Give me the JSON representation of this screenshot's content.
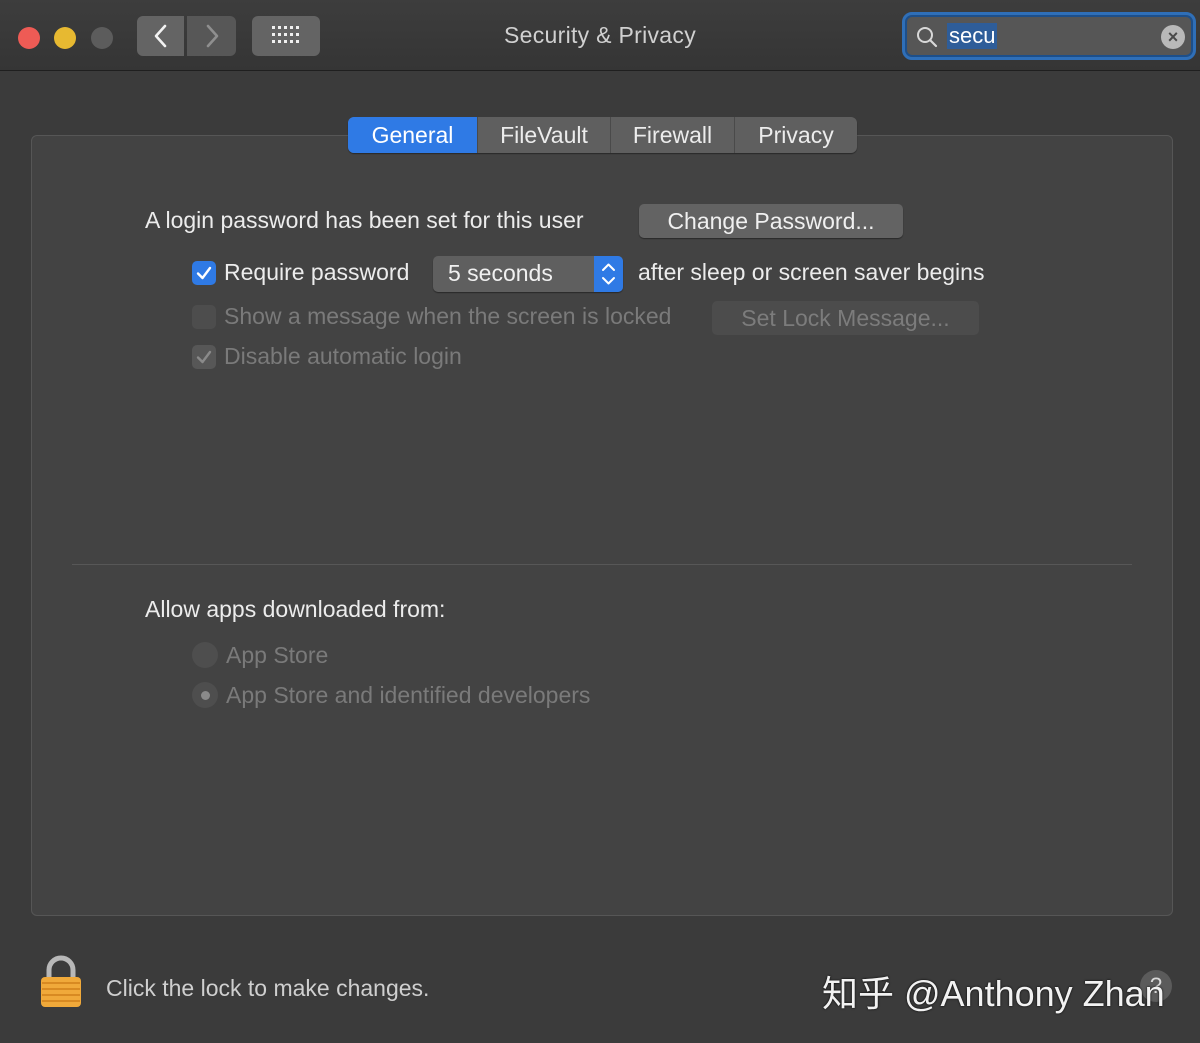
{
  "window": {
    "title": "Security & Privacy"
  },
  "search": {
    "value": "secu",
    "icon": "search-icon",
    "clear_icon": "clear-icon"
  },
  "tabs": [
    {
      "label": "General",
      "active": true
    },
    {
      "label": "FileVault",
      "active": false
    },
    {
      "label": "Firewall",
      "active": false
    },
    {
      "label": "Privacy",
      "active": false
    }
  ],
  "general": {
    "login_password_text": "A login password has been set for this user",
    "change_password_button": "Change Password...",
    "require_password_label": "Require password",
    "require_password_checked": true,
    "require_password_delay": "5 seconds",
    "after_sleep_text": "after sleep or screen saver begins",
    "show_message_label": "Show a message when the screen is locked",
    "show_message_checked": false,
    "set_lock_message_button": "Set Lock Message...",
    "disable_auto_login_label": "Disable automatic login",
    "disable_auto_login_checked": true
  },
  "gatekeeper": {
    "heading": "Allow apps downloaded from:",
    "options": [
      {
        "label": "App Store",
        "selected": false
      },
      {
        "label": "App Store and identified developers",
        "selected": true
      }
    ]
  },
  "footer": {
    "lock_text": "Click the lock to make changes.",
    "watermark": "知乎 @Anthony Zhan",
    "help_label": "?"
  },
  "colors": {
    "accent": "#2f7ae5",
    "close": "#ee5b55",
    "minimize": "#e7b931",
    "zoom_disabled": "#5c5c5c"
  }
}
